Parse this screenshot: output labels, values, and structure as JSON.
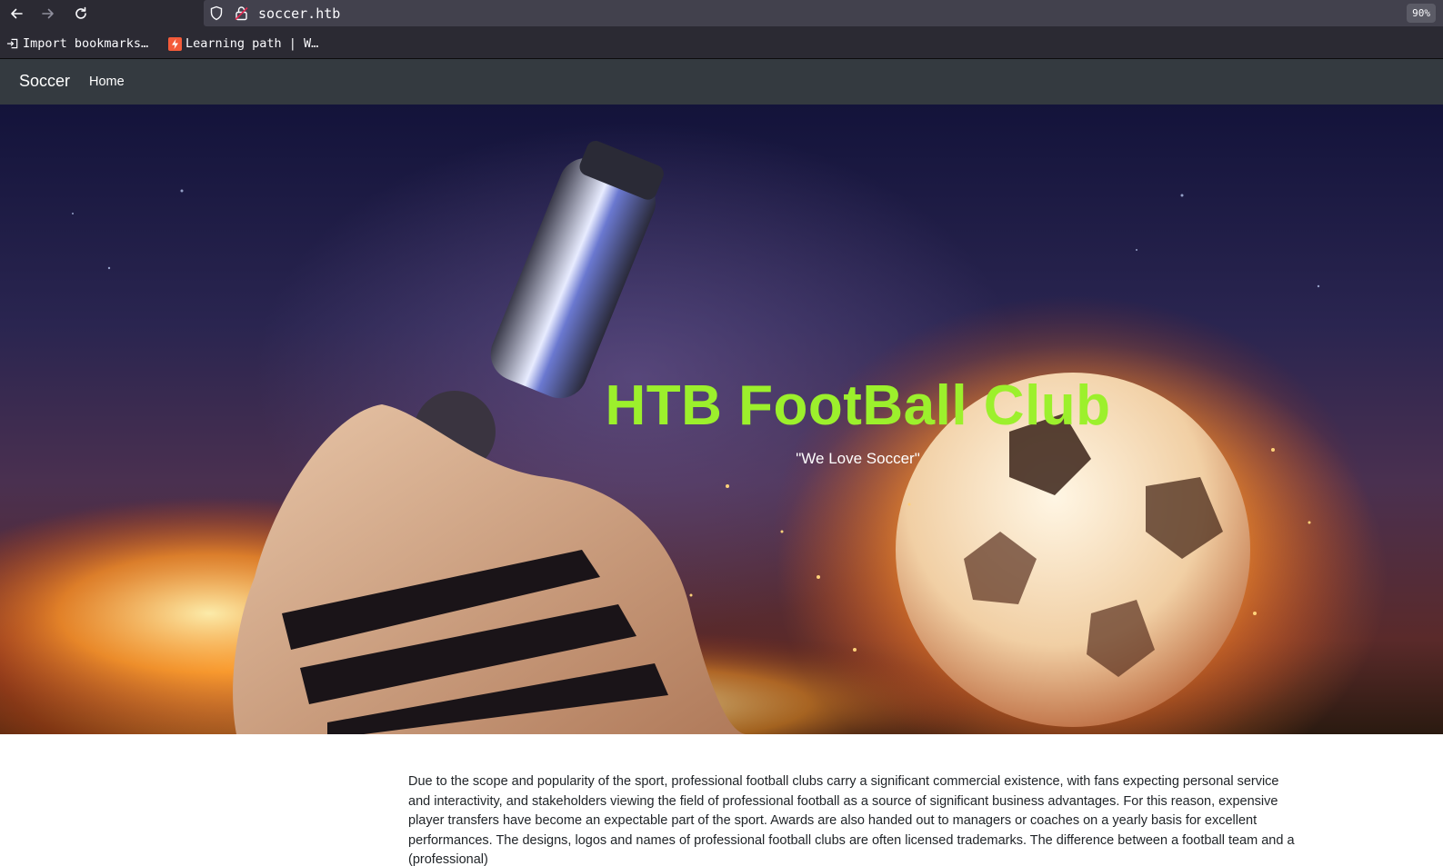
{
  "browser": {
    "url": "soccer.htb",
    "zoom": "90%",
    "bookmarks": [
      {
        "label": "Import bookmarks…",
        "icon": "import-icon"
      },
      {
        "label": "Learning path | W…",
        "icon": "bolt-favicon-icon"
      }
    ]
  },
  "site": {
    "brand": "Soccer",
    "nav_home": "Home"
  },
  "hero": {
    "title": "HTB FootBall Club",
    "subtitle": "\"We Love Soccer\""
  },
  "content": {
    "paragraph": "Due to the scope and popularity of the sport, professional football clubs carry a significant commercial existence, with fans expecting personal service and interactivity, and stakeholders viewing the field of professional football as a source of significant business advantages. For this reason, expensive player transfers have become an expectable part of the sport. Awards are also handed out to managers or coaches on a yearly basis for excellent performances. The designs, logos and names of professional football clubs are often licensed trademarks. The difference between a football team and a (professional)"
  },
  "colors": {
    "hero_title": "#9cf02c",
    "navbar_bg": "#343a40",
    "chrome_bg": "#2b2a33"
  }
}
